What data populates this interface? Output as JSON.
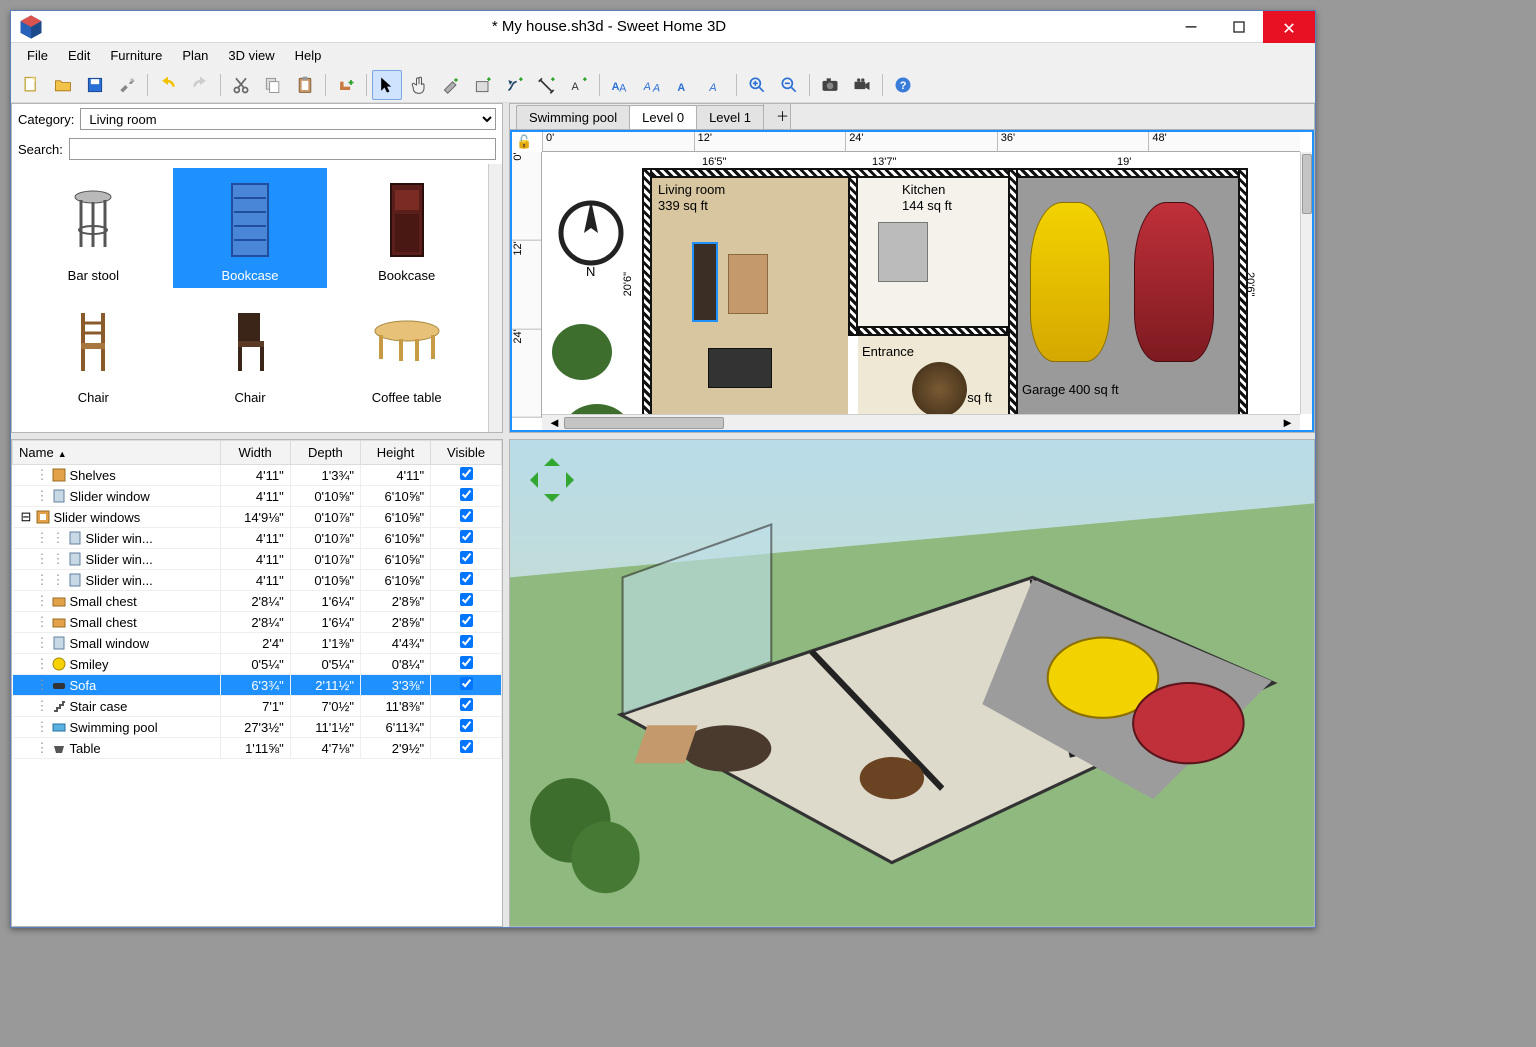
{
  "window": {
    "title": "* My house.sh3d - Sweet Home 3D"
  },
  "menubar": [
    "File",
    "Edit",
    "Furniture",
    "Plan",
    "3D view",
    "Help"
  ],
  "toolbar": [
    {
      "name": "new-file-icon"
    },
    {
      "name": "open-file-icon"
    },
    {
      "name": "save-file-icon"
    },
    {
      "name": "preferences-icon"
    },
    {
      "sep": true
    },
    {
      "name": "undo-icon"
    },
    {
      "name": "redo-icon"
    },
    {
      "sep": true
    },
    {
      "name": "cut-icon"
    },
    {
      "name": "copy-icon"
    },
    {
      "name": "paste-icon"
    },
    {
      "sep": true
    },
    {
      "name": "add-furniture-icon"
    },
    {
      "sep": true
    },
    {
      "name": "select-tool-icon",
      "selected": true
    },
    {
      "name": "pan-tool-icon"
    },
    {
      "name": "create-walls-icon"
    },
    {
      "name": "create-rooms-icon"
    },
    {
      "name": "create-polylines-icon"
    },
    {
      "name": "create-dimensions-icon"
    },
    {
      "name": "create-text-icon"
    },
    {
      "sep": true
    },
    {
      "name": "text-bold-icon"
    },
    {
      "name": "text-italic-icon"
    },
    {
      "name": "text-increase-icon"
    },
    {
      "name": "text-decrease-icon"
    },
    {
      "sep": true
    },
    {
      "name": "zoom-in-icon"
    },
    {
      "name": "zoom-out-icon"
    },
    {
      "sep": true
    },
    {
      "name": "photo-icon"
    },
    {
      "name": "video-icon"
    },
    {
      "sep": true
    },
    {
      "name": "help-icon"
    }
  ],
  "catalog": {
    "category_label": "Category:",
    "category_value": "Living room",
    "search_label": "Search:",
    "search_value": "",
    "items": [
      {
        "label": "Bar stool",
        "name": "bar-stool"
      },
      {
        "label": "Bookcase",
        "name": "bookcase-open",
        "selected": true
      },
      {
        "label": "Bookcase",
        "name": "bookcase-closed"
      },
      {
        "label": "Chair",
        "name": "chair-1"
      },
      {
        "label": "Chair",
        "name": "chair-2"
      },
      {
        "label": "Coffee table",
        "name": "coffee-table"
      }
    ]
  },
  "furniture_table": {
    "columns": {
      "name": "Name",
      "width": "Width",
      "depth": "Depth",
      "height": "Height",
      "visible": "Visible"
    },
    "rows": [
      {
        "indent": 1,
        "icon": "shelves",
        "name": "Shelves",
        "w": "4'11\"",
        "d": "1'3¾\"",
        "h": "4'11\"",
        "v": true
      },
      {
        "indent": 1,
        "icon": "window",
        "name": "Slider window",
        "w": "4'11\"",
        "d": "0'10⅝\"",
        "h": "6'10⅝\"",
        "v": true
      },
      {
        "indent": 0,
        "expand": "-",
        "icon": "group",
        "name": "Slider windows",
        "w": "14'9⅛\"",
        "d": "0'10⅞\"",
        "h": "6'10⅝\"",
        "v": true
      },
      {
        "indent": 2,
        "icon": "window",
        "name": "Slider win...",
        "w": "4'11\"",
        "d": "0'10⅞\"",
        "h": "6'10⅝\"",
        "v": true
      },
      {
        "indent": 2,
        "icon": "window",
        "name": "Slider win...",
        "w": "4'11\"",
        "d": "0'10⅞\"",
        "h": "6'10⅝\"",
        "v": true
      },
      {
        "indent": 2,
        "icon": "window",
        "name": "Slider win...",
        "w": "4'11\"",
        "d": "0'10⅝\"",
        "h": "6'10⅝\"",
        "v": true
      },
      {
        "indent": 1,
        "icon": "chest",
        "name": "Small chest",
        "w": "2'8¼\"",
        "d": "1'6¼\"",
        "h": "2'8⅝\"",
        "v": true
      },
      {
        "indent": 1,
        "icon": "chest",
        "name": "Small chest",
        "w": "2'8¼\"",
        "d": "1'6¼\"",
        "h": "2'8⅝\"",
        "v": true
      },
      {
        "indent": 1,
        "icon": "window",
        "name": "Small window",
        "w": "2'4\"",
        "d": "1'1⅜\"",
        "h": "4'4¾\"",
        "v": true
      },
      {
        "indent": 1,
        "icon": "smiley",
        "name": "Smiley",
        "w": "0'5¼\"",
        "d": "0'5¼\"",
        "h": "0'8¼\"",
        "v": true
      },
      {
        "indent": 1,
        "icon": "sofa",
        "name": "Sofa",
        "w": "6'3¾\"",
        "d": "2'11½\"",
        "h": "3'3⅜\"",
        "v": true,
        "selected": true
      },
      {
        "indent": 1,
        "icon": "stairs",
        "name": "Stair case",
        "w": "7'1\"",
        "d": "7'0½\"",
        "h": "11'8⅜\"",
        "v": true
      },
      {
        "indent": 1,
        "icon": "pool",
        "name": "Swimming pool",
        "w": "27'3½\"",
        "d": "11'1½\"",
        "h": "6'11¾\"",
        "v": true
      },
      {
        "indent": 1,
        "icon": "table",
        "name": "Table",
        "w": "1'11⅝\"",
        "d": "4'7⅛\"",
        "h": "2'9½\"",
        "v": true
      }
    ]
  },
  "plan": {
    "tabs": [
      {
        "label": "Swimming pool"
      },
      {
        "label": "Level 0",
        "active": true
      },
      {
        "label": "Level 1"
      },
      {
        "label": "＋",
        "plus": true
      }
    ],
    "ruler_h": [
      "0'",
      "12'",
      "24'",
      "36'",
      "48'"
    ],
    "ruler_v": [
      "0'",
      "12'",
      "24'"
    ],
    "rooms": [
      {
        "label": "Living room",
        "area": "339 sq ft"
      },
      {
        "label": "Kitchen",
        "area": "144 sq ft"
      },
      {
        "label": "Entrance",
        "area": "169 sq ft"
      },
      {
        "label": "Garage",
        "area": "400 sq ft"
      }
    ],
    "dimensions": {
      "d1": "16'5\"",
      "d2": "13'7\"",
      "d3": "19'",
      "side1": "20'6\"",
      "side2": "20'6\""
    }
  }
}
